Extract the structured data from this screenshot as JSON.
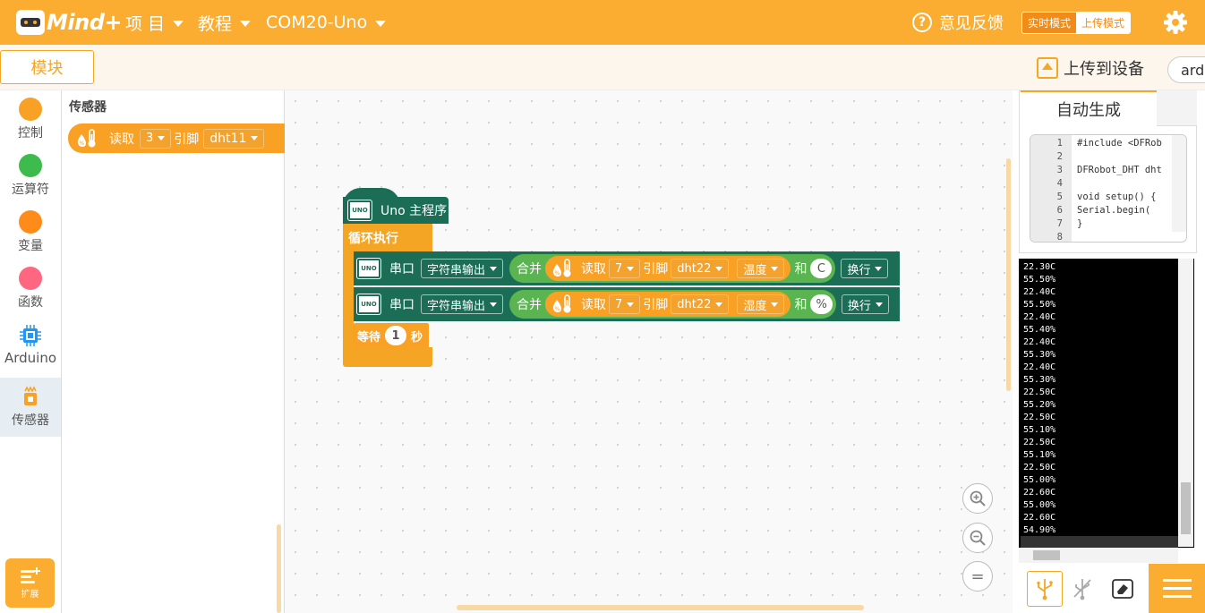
{
  "app": {
    "logo_text": "Mind+"
  },
  "topbar": {
    "menus": [
      {
        "label": "项 目"
      },
      {
        "label": "教程"
      },
      {
        "label": "COM20-Uno"
      }
    ],
    "feedback_label": "意见反馈",
    "mode_realtime": "实时模式",
    "mode_upload": "上传模式"
  },
  "toolbar": {
    "modules_tab": "模块",
    "upload_label": "上传到设备",
    "language_value": "ardu"
  },
  "categories": [
    {
      "label": "控制",
      "color": "#f9a125"
    },
    {
      "label": "运算符",
      "color": "#3dbb4c"
    },
    {
      "label": "变量",
      "color": "#ff8c1a"
    },
    {
      "label": "函数",
      "color": "#ff6680"
    },
    {
      "label": "Arduino",
      "color": "#2196f3"
    },
    {
      "label": "传感器",
      "color": "#f9a125"
    }
  ],
  "extension_label": "扩展",
  "flyout": {
    "title": "传感器",
    "block": {
      "read": "读取",
      "pin": "3",
      "pin_label": "引脚",
      "sensor": "dht11"
    }
  },
  "program": {
    "hat_label": "Uno 主程序",
    "loop_label": "循环执行",
    "rows": [
      {
        "serial": "串口",
        "mode": "字符串输出",
        "join": "合并",
        "read": "读取",
        "pin": "7",
        "pin_label": "引脚",
        "sensor": "dht22",
        "measure": "温度",
        "and": "和",
        "suffix": "C",
        "newline": "换行"
      },
      {
        "serial": "串口",
        "mode": "字符串输出",
        "join": "合并",
        "read": "读取",
        "pin": "7",
        "pin_label": "引脚",
        "sensor": "dht22",
        "measure": "湿度",
        "and": "和",
        "suffix": "%",
        "newline": "换行"
      }
    ],
    "wait_label": "等待",
    "wait_value": "1",
    "wait_unit": "秒"
  },
  "code_panel": {
    "tab_label": "自动生成",
    "lines": [
      {
        "n": "1",
        "text": "#include <DFRob"
      },
      {
        "n": "2",
        "text": ""
      },
      {
        "n": "3",
        "text": "DFRobot_DHT dht"
      },
      {
        "n": "4",
        "text": ""
      },
      {
        "n": "5",
        "text": "void setup() {"
      },
      {
        "n": "6",
        "text": "  Serial.begin("
      },
      {
        "n": "7",
        "text": "}"
      },
      {
        "n": "8",
        "text": ""
      }
    ]
  },
  "serial_monitor": {
    "lines": [
      "22.30C",
      "55.50%",
      "22.40C",
      "55.50%",
      "22.40C",
      "55.40%",
      "22.40C",
      "55.30%",
      "22.40C",
      "55.30%",
      "22.50C",
      "55.20%",
      "22.50C",
      "55.10%",
      "22.50C",
      "55.10%",
      "22.50C",
      "55.00%",
      "22.60C",
      "55.00%",
      "22.60C",
      "54.90%"
    ]
  }
}
